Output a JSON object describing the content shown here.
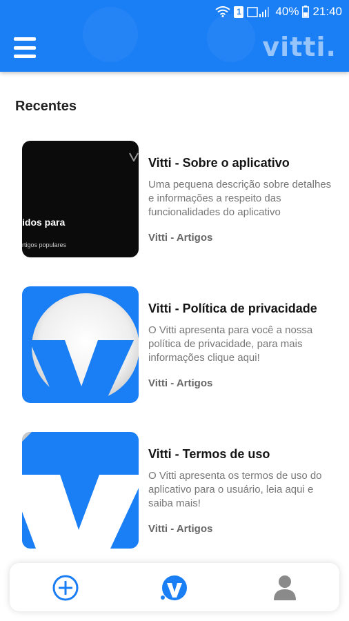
{
  "status_bar": {
    "battery": "40%",
    "time": "21:40",
    "sim_badge": "1",
    "icons": [
      "wifi-icon",
      "sim-icon",
      "signal-icon",
      "battery-icon"
    ]
  },
  "app_bar": {
    "brand": "vitti.",
    "menu_icon": "hamburger-menu-icon",
    "color": "#1a7ef5"
  },
  "section": {
    "title": "Recentes"
  },
  "articles": [
    {
      "title": "Vitti - Sobre o aplicativo",
      "description": "Uma pequena descrição sobre detalhes e informações a respeito das funcionalidades do aplicativo",
      "source": "Vitti - Artigos",
      "thumb_text": "idos para",
      "thumb_sub": "rtigos populares"
    },
    {
      "title": "Vitti - Política de privacidade",
      "description": "O Vitti apresenta para você a nossa política de privacidade, para mais informações clique aqui!",
      "source": "Vitti - Artigos"
    },
    {
      "title": "Vitti - Termos de uso",
      "description": "O Vitti apresenta os termos de uso do aplicativo para o usuário, leia aqui e saiba mais!",
      "source": "Vitti - Artigos"
    }
  ],
  "bottom_nav": {
    "items": [
      "add-circle-icon",
      "vitti-logo-icon",
      "profile-icon"
    ],
    "active_color": "#1a7ef5",
    "inactive_color": "#8a8a8a"
  }
}
